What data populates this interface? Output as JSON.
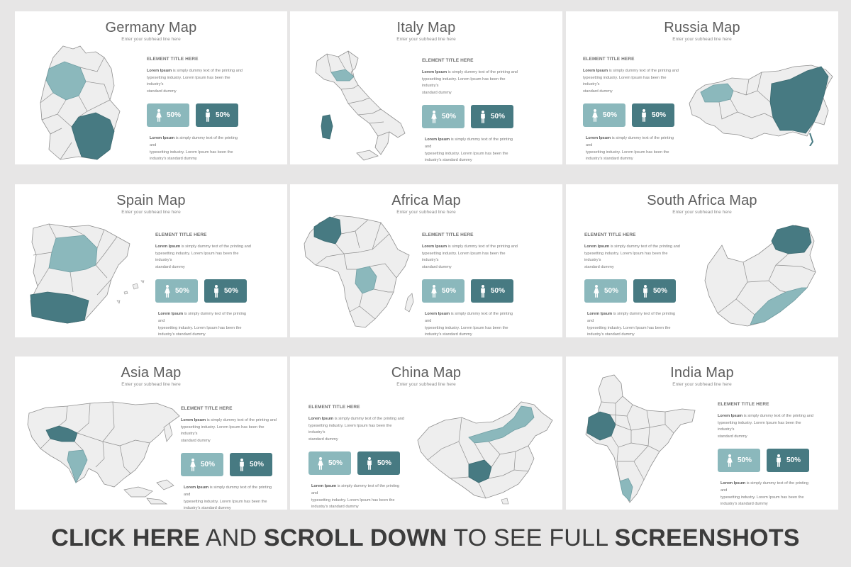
{
  "colors": {
    "light": "#8bb8bc",
    "dark": "#477a82",
    "base": "#eeeeee",
    "stroke": "#8f8f8f"
  },
  "common": {
    "subhead": "Enter your subhead line here",
    "element_title": "ELEMENT TITLE HERE",
    "lorem_bold": "Lorem Ipsum",
    "para1_rest": " is simply dummy text of the printing and\ntypesetting industry. Lorem Ipsum has been the industry's\nstandard dummy",
    "para2_rest": " is simply dummy text of the printing and\ntypesetting industry. Lorem Ipsum has been the\nindustry's standard dummy",
    "female_value": "50%",
    "male_value": "50%",
    "female_icon": "female-person-icon",
    "male_icon": "male-person-icon"
  },
  "slides": [
    {
      "title": "Germany Map"
    },
    {
      "title": "Italy Map"
    },
    {
      "title": "Russia Map"
    },
    {
      "title": "Spain Map"
    },
    {
      "title": "Africa Map"
    },
    {
      "title": "South Africa Map"
    },
    {
      "title": "Asia Map"
    },
    {
      "title": "China Map"
    },
    {
      "title": "India Map"
    }
  ],
  "cta": {
    "part1": "CLICK HERE",
    "part2": " AND ",
    "part3": "SCROLL DOWN",
    "part4": " TO SEE FULL ",
    "part5": "SCREENSHOTS"
  }
}
